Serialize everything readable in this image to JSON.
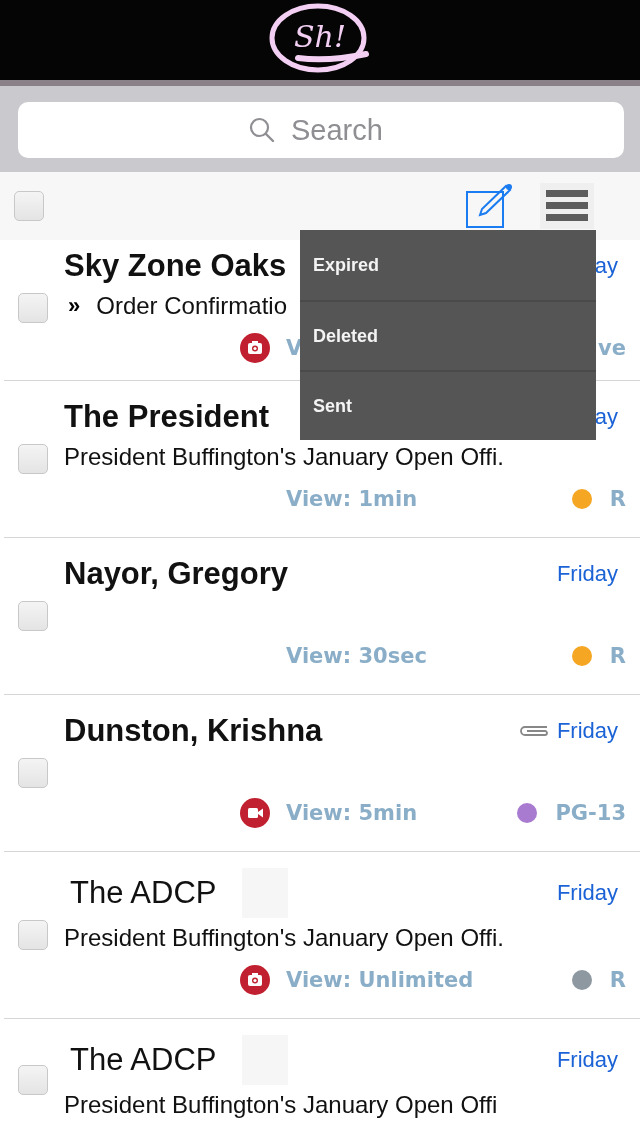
{
  "logo": {
    "text": "Sh!"
  },
  "search": {
    "placeholder": "Search"
  },
  "toolbar": {
    "select_all": {
      "checked": false
    }
  },
  "menu": {
    "items": [
      {
        "label": "Expired"
      },
      {
        "label": "Deleted"
      },
      {
        "label": "Sent"
      }
    ]
  },
  "messages": [
    {
      "sender": "Sky Zone Oaks",
      "bold": true,
      "thumbnail": false,
      "forward_mark": "»",
      "subject": "Order Confirmatio",
      "date": "ay",
      "attachment": false,
      "media_icon": {
        "kind": "camera"
      },
      "view": "V",
      "rating": "ve",
      "checked": false
    },
    {
      "sender": "The President",
      "bold": true,
      "thumbnail": false,
      "subject": "President Buffington's January Open Offi.",
      "date": "ay",
      "attachment": false,
      "view": "View: 1min",
      "color": "#f5a623",
      "rating": "R",
      "checked": false
    },
    {
      "sender": "Nayor, Gregory",
      "bold": true,
      "thumbnail": false,
      "date": "Friday",
      "attachment": false,
      "view": "View: 30sec",
      "color": "#f5a623",
      "rating": "R",
      "checked": false
    },
    {
      "sender": "Dunston, Krishna",
      "bold": true,
      "thumbnail": false,
      "date": "Friday",
      "attachment": true,
      "media_icon": {
        "kind": "video"
      },
      "view": "View: 5min",
      "color": "#a87bd1",
      "rating": "PG-13",
      "checked": false
    },
    {
      "sender": "The ADCP",
      "bold": false,
      "thumbnail": true,
      "subject": "President Buffington's January Open Offi.",
      "date": "Friday",
      "attachment": false,
      "media_icon": {
        "kind": "camera"
      },
      "view": "View: Unlimited",
      "color": "#8d98a0",
      "rating": "R",
      "checked": false
    },
    {
      "sender": "The ADCP",
      "bold": false,
      "thumbnail": true,
      "subject": "President Buffington's January Open Offi",
      "date": "Friday",
      "attachment": false,
      "checked": false
    }
  ]
}
